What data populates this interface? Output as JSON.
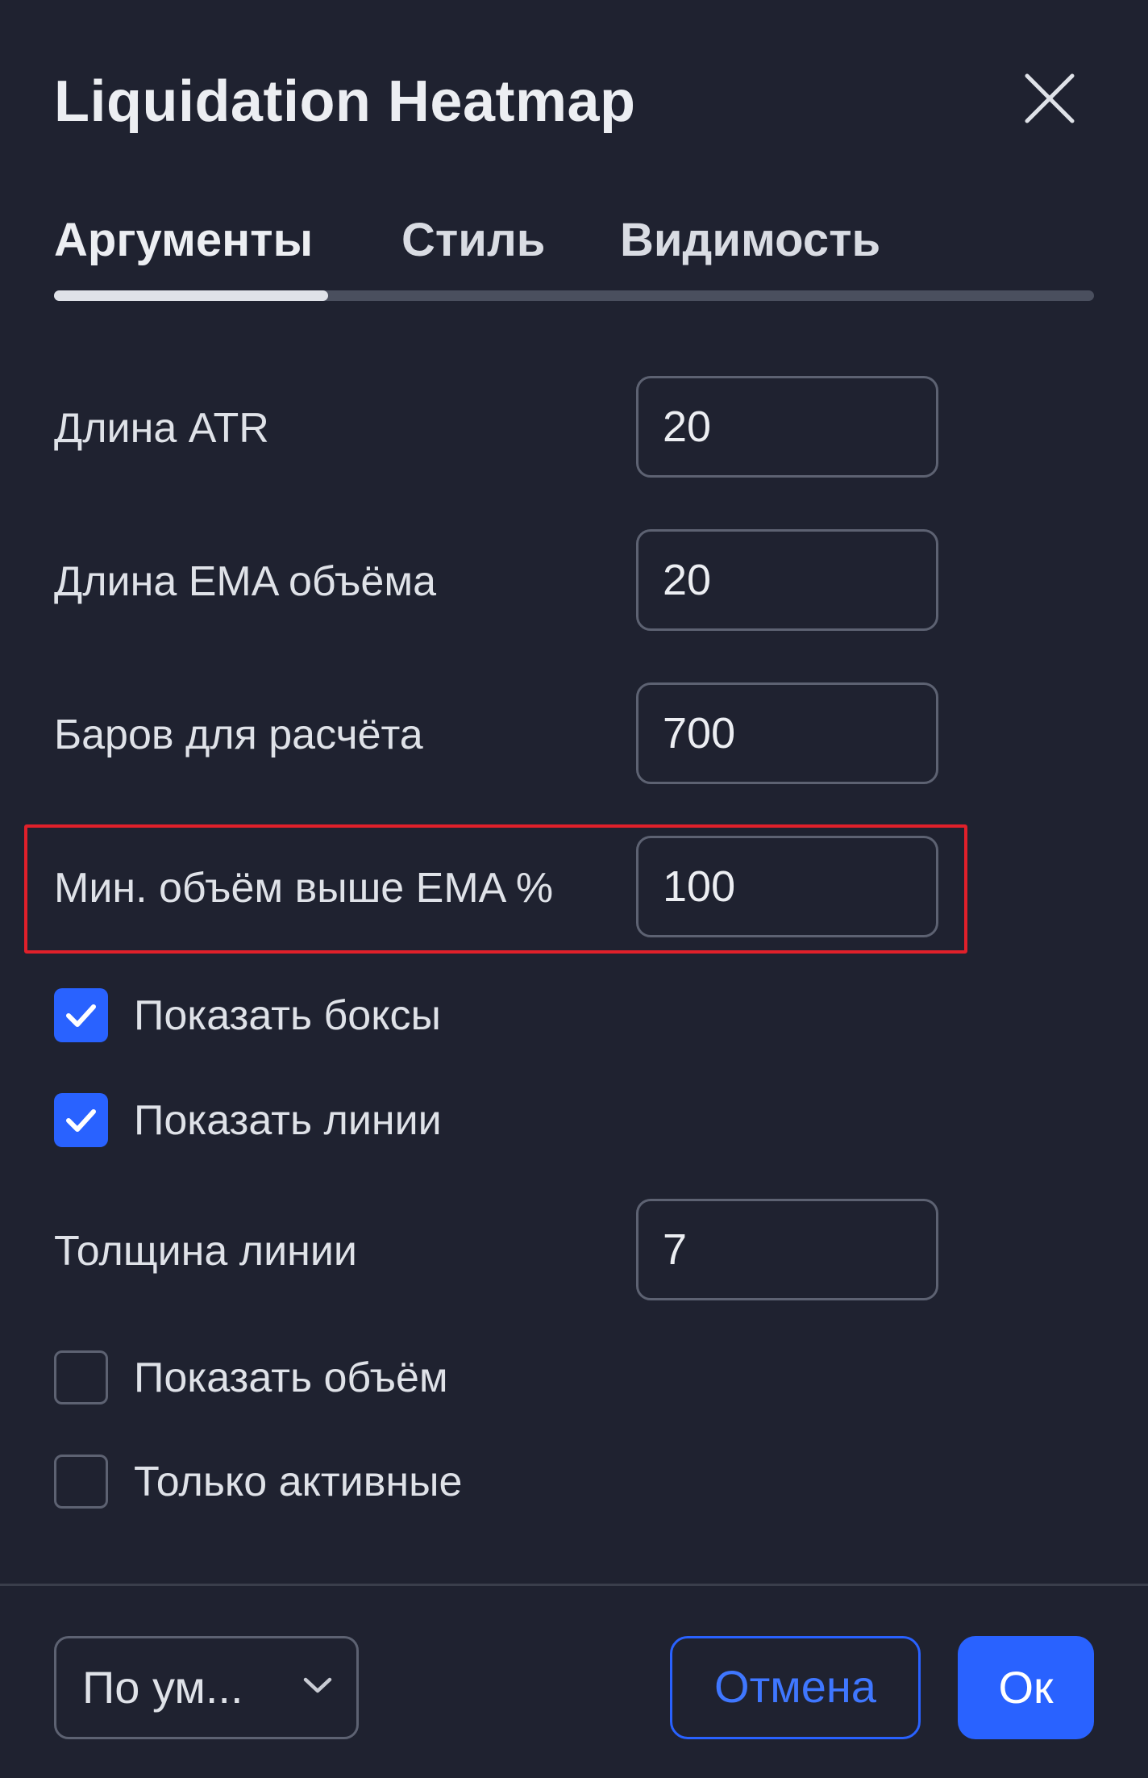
{
  "dialog": {
    "title": "Liquidation Heatmap"
  },
  "tabs": [
    {
      "label": "Аргументы",
      "active": true
    },
    {
      "label": "Стиль",
      "active": false
    },
    {
      "label": "Видимость",
      "active": false
    }
  ],
  "fields": {
    "atr_length": {
      "label": "Длина ATR",
      "value": "20"
    },
    "volume_ema_length": {
      "label": "Длина EMA объёма",
      "value": "20"
    },
    "bars_to_calc": {
      "label": "Баров для расчёта",
      "value": "700"
    },
    "min_volume_above_ema": {
      "label": "Мин. объём выше EMA %",
      "value": "100"
    },
    "line_width": {
      "label": "Толщина линии",
      "value": "7"
    }
  },
  "checkboxes": {
    "show_boxes": {
      "label": "Показать боксы",
      "checked": true
    },
    "show_lines": {
      "label": "Показать линии",
      "checked": true
    },
    "show_volume": {
      "label": "Показать объём",
      "checked": false
    },
    "only_active": {
      "label": "Только активные",
      "checked": false
    }
  },
  "footer": {
    "preset_label": "По ум...",
    "cancel_label": "Отмена",
    "ok_label": "Ок"
  },
  "colors": {
    "background": "#1f2230",
    "accent": "#2962ff",
    "highlight_border": "#e0202a"
  },
  "icons": {
    "close": "close-icon",
    "check": "checkmark-icon",
    "chevron": "chevron-down-icon"
  }
}
